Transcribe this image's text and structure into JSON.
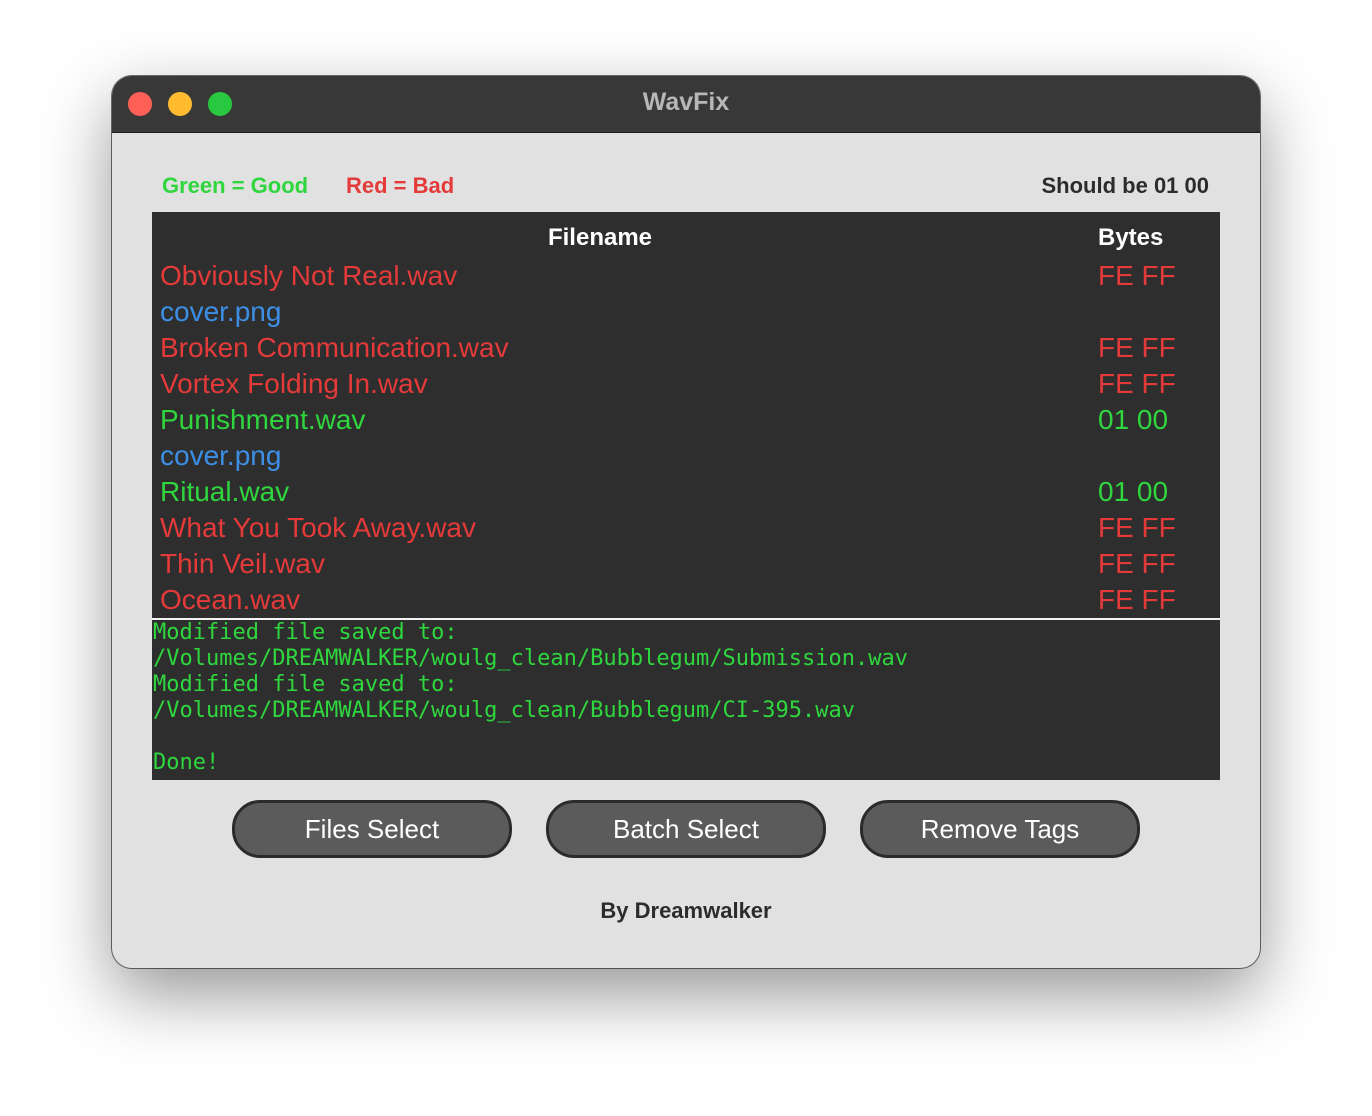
{
  "window": {
    "title": "WavFix"
  },
  "legend": {
    "good": "Green = Good",
    "bad": "Red = Bad",
    "should": "Should be 01 00"
  },
  "colors": {
    "good": "#2fd63e",
    "bad": "#e43a3a",
    "other": "#3d8fe6"
  },
  "table": {
    "headers": {
      "filename": "Filename",
      "bytes": "Bytes"
    },
    "rows": [
      {
        "filename": "Obviously Not Real.wav",
        "bytes": "FE FF",
        "status": "bad"
      },
      {
        "filename": "cover.png",
        "bytes": "",
        "status": "other"
      },
      {
        "filename": "Broken Communication.wav",
        "bytes": "FE FF",
        "status": "bad"
      },
      {
        "filename": "Vortex Folding In.wav",
        "bytes": "FE FF",
        "status": "bad"
      },
      {
        "filename": "Punishment.wav",
        "bytes": "01 00",
        "status": "good"
      },
      {
        "filename": "cover.png",
        "bytes": "",
        "status": "other"
      },
      {
        "filename": "Ritual.wav",
        "bytes": "01 00",
        "status": "good"
      },
      {
        "filename": "What You Took Away.wav",
        "bytes": "FE FF",
        "status": "bad"
      },
      {
        "filename": "Thin Veil.wav",
        "bytes": "FE FF",
        "status": "bad"
      },
      {
        "filename": "Ocean.wav",
        "bytes": "FE FF",
        "status": "bad"
      }
    ]
  },
  "console": {
    "lines": [
      "Modified file saved to:",
      "/Volumes/DREAMWALKER/woulg_clean/Bubblegum/Submission.wav",
      "Modified file saved to:",
      "/Volumes/DREAMWALKER/woulg_clean/Bubblegum/CI-395.wav",
      "",
      "Done!"
    ]
  },
  "buttons": {
    "files_select": "Files Select",
    "batch_select": "Batch Select",
    "remove_tags": "Remove Tags"
  },
  "footer": {
    "credit": "By Dreamwalker"
  }
}
